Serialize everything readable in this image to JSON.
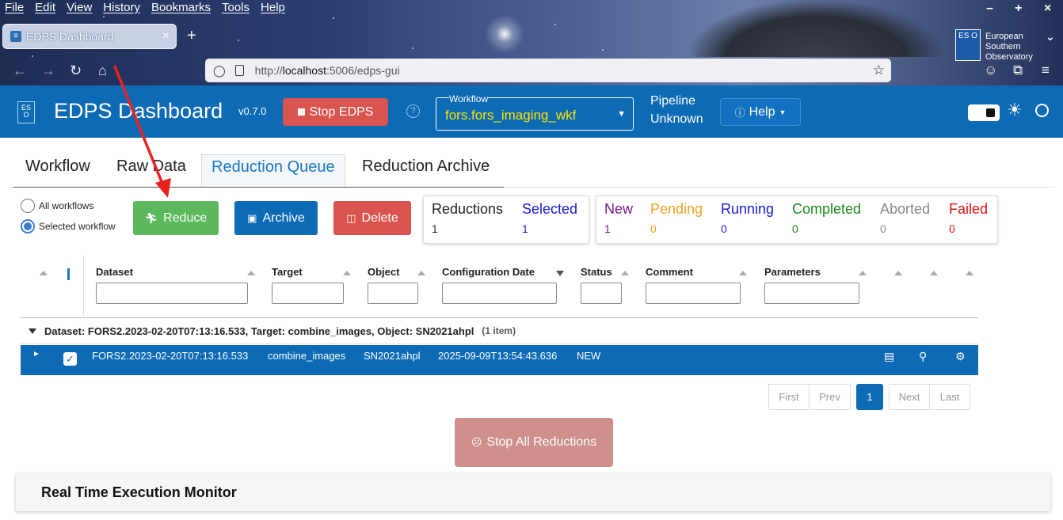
{
  "browser": {
    "menu": [
      "File",
      "Edit",
      "View",
      "History",
      "Bookmarks",
      "Tools",
      "Help"
    ],
    "tab_title": "EDPS Dashboard",
    "url_prefix": "http://",
    "url_host": "localhost",
    "url_rest": ":5006/edps-gui",
    "eso_badge": {
      "short": "ES O",
      "line1": "European",
      "line2": "Southern",
      "line3": "Observatory"
    }
  },
  "header": {
    "title": "EDPS Dashboard",
    "version": "v0.7.0",
    "stop_label": "Stop EDPS",
    "workflow_label": "Workflow",
    "workflow_value": "fors.fors_imaging_wkf",
    "pipeline_line1": "Pipeline",
    "pipeline_line2": "Unknown",
    "help_label": "Help",
    "accent": "#0d6ab5",
    "workflow_color": "#ffe600"
  },
  "tabs": [
    "Workflow",
    "Raw Data",
    "Reduction Queue",
    "Reduction Archive"
  ],
  "active_tab": "Reduction Queue",
  "scope": {
    "all_label": "All workflows",
    "selected_label": "Selected workflow",
    "selected": "Selected workflow"
  },
  "actions": {
    "reduce": "Reduce",
    "archive": "Archive",
    "delete": "Delete"
  },
  "counts": {
    "reductions": {
      "label": "Reductions",
      "value": "1"
    },
    "selected": {
      "label": "Selected",
      "value": "1",
      "color": "#1a1ad6"
    },
    "new": {
      "label": "New",
      "value": "1",
      "color": "#7a1a8c"
    },
    "pending": {
      "label": "Pending",
      "value": "0",
      "color": "#f0a020"
    },
    "running": {
      "label": "Running",
      "value": "0",
      "color": "#1a1ad6"
    },
    "completed": {
      "label": "Completed",
      "value": "0",
      "color": "#1a8a1a"
    },
    "aborted": {
      "label": "Aborted",
      "value": "0",
      "color": "#888888"
    },
    "failed": {
      "label": "Failed",
      "value": "0",
      "color": "#e01010"
    }
  },
  "columns": [
    "Dataset",
    "Target",
    "Object",
    "Configuration Date",
    "Status",
    "Comment",
    "Parameters"
  ],
  "group": {
    "label": "Dataset: FORS2.2023-02-20T07:13:16.533, Target: combine_images, Object: SN2021ahpl",
    "count": "(1 item)"
  },
  "rows": [
    {
      "dataset": "FORS2.2023-02-20T07:13:16.533",
      "target": "combine_images",
      "object": "SN2021ahpl",
      "config_date": "2025-09-09T13:54:43.636",
      "status": "NEW",
      "checked": true
    }
  ],
  "pagination": {
    "first": "First",
    "prev": "Prev",
    "current": "1",
    "next": "Next",
    "last": "Last"
  },
  "stop_all_label": "Stop All Reductions",
  "monitor_title": "Real Time Execution Monitor"
}
